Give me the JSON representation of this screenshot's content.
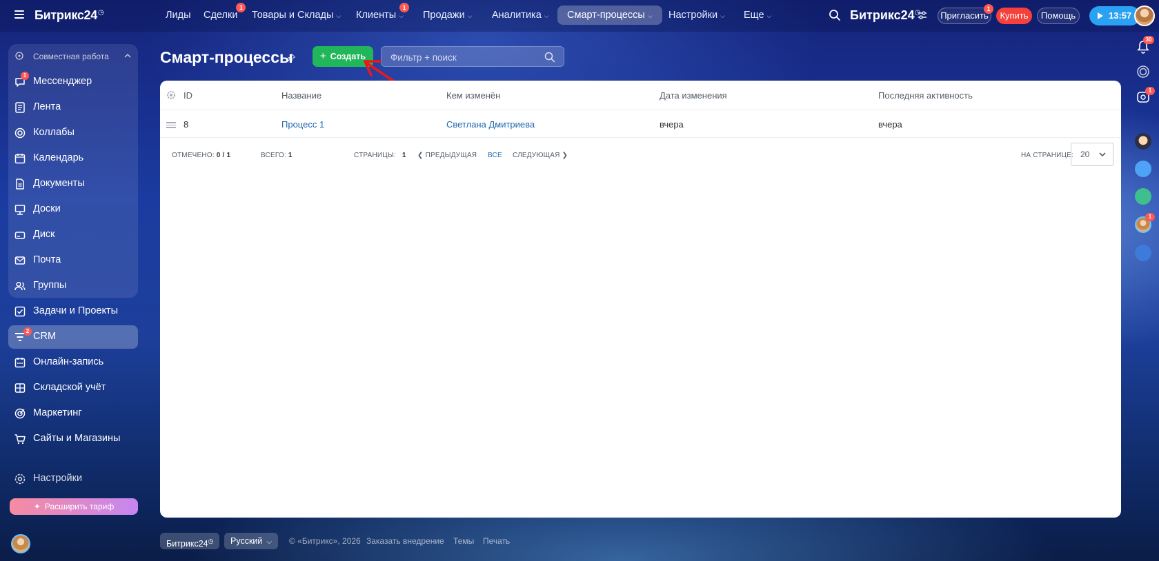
{
  "app": {
    "logo": "Битрикс24",
    "brand": "Битрикс24"
  },
  "topnav": {
    "items": [
      {
        "label": "Лиды",
        "badge": ""
      },
      {
        "label": "Сделки",
        "badge": "1"
      },
      {
        "label": "Товары и Склады",
        "badge": ""
      },
      {
        "label": "Клиенты",
        "badge": "1"
      },
      {
        "label": "Продажи",
        "badge": ""
      },
      {
        "label": "Аналитика",
        "badge": ""
      },
      {
        "label": "Смарт-процессы",
        "badge": ""
      },
      {
        "label": "Настройки",
        "badge": ""
      },
      {
        "label": "Еще",
        "badge": ""
      }
    ],
    "active": "Смарт-процессы"
  },
  "header_actions": {
    "invite": "Пригласить",
    "invite_badge": "1",
    "buy": "Купить",
    "help": "Помощь",
    "time": "13:57"
  },
  "sidebar": {
    "group_title": "Совместная работа",
    "group_items": [
      {
        "label": "Мессенджер",
        "badge": "1"
      },
      {
        "label": "Лента"
      },
      {
        "label": "Коллабы"
      },
      {
        "label": "Календарь"
      },
      {
        "label": "Документы"
      },
      {
        "label": "Доски"
      },
      {
        "label": "Диск"
      },
      {
        "label": "Почта"
      },
      {
        "label": "Группы"
      }
    ],
    "items": [
      {
        "label": "Задачи и Проекты"
      },
      {
        "label": "CRM",
        "badge": "2"
      },
      {
        "label": "Онлайн-запись"
      },
      {
        "label": "Складской учёт"
      },
      {
        "label": "Маркетинг"
      },
      {
        "label": "Сайты и Магазины"
      }
    ],
    "settings": "Настройки",
    "upgrade": "Расширить тариф"
  },
  "page": {
    "title": "Смарт-процессы",
    "create_label": "Создать",
    "filter_placeholder": "Фильтр + поиск"
  },
  "grid": {
    "columns": [
      "ID",
      "Название",
      "Кем изменён",
      "Дата изменения",
      "Последняя активность"
    ],
    "rows": [
      {
        "id": "8",
        "name": "Процесс 1",
        "modified_by": "Светлана Дмитриева",
        "modified_date": "вчера",
        "last_activity": "вчера"
      }
    ],
    "footer": {
      "selected_label": "Отмечено:",
      "selected_value": "0 / 1",
      "total_label": "Всего:",
      "total_value": "1",
      "pages_label": "Страницы:",
      "pages_value": "1",
      "prev": "Предыдущая",
      "all": "Все",
      "next": "Следующая",
      "per_page_label": "На странице:",
      "per_page_value": "20"
    }
  },
  "footer": {
    "brand": "Битрикс24",
    "language": "Русский",
    "copyright": "© «Битрикс», 2026",
    "order": "Заказать внедрение",
    "themes": "Темы",
    "print": "Печать"
  },
  "right_rail": {
    "notifications_badge": "30",
    "chat_badge": "1",
    "avatar_badge": "1"
  },
  "colors": {
    "accent_green": "#22b65a",
    "buy_red": "#f5413b",
    "link_blue": "#2067b0",
    "time_blue": "#2aa1f2",
    "annotation_arrow": "#f01616"
  },
  "annotation": {
    "type": "arrow",
    "target": "create-button"
  }
}
